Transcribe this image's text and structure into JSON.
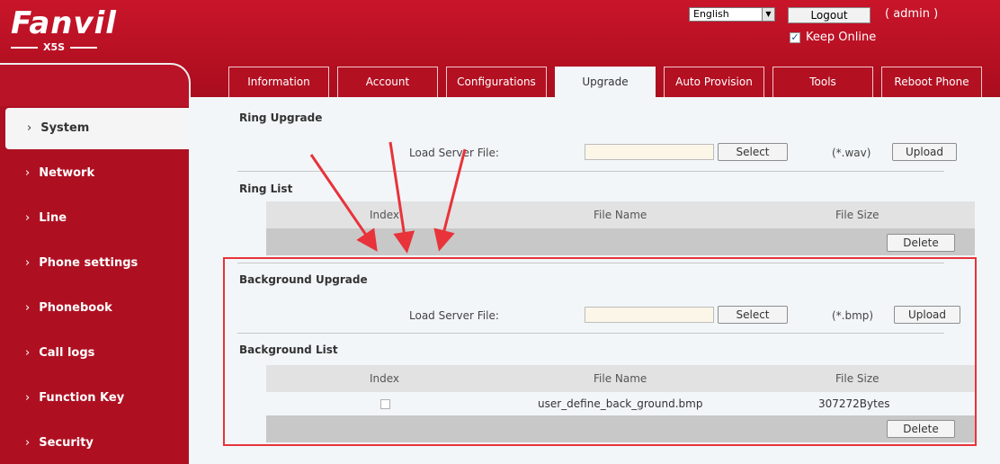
{
  "header": {
    "logo_text": "Fanvil",
    "model": "X5S",
    "language": "English",
    "logout_label": "Logout",
    "user_label": "( admin )",
    "keep_online_label": "Keep Online",
    "keep_online_checked": true
  },
  "tabs": [
    {
      "label": "Information",
      "active": false
    },
    {
      "label": "Account",
      "active": false
    },
    {
      "label": "Configurations",
      "active": false
    },
    {
      "label": "Upgrade",
      "active": true
    },
    {
      "label": "Auto Provision",
      "active": false
    },
    {
      "label": "Tools",
      "active": false
    },
    {
      "label": "Reboot Phone",
      "active": false
    }
  ],
  "sidebar": {
    "items": [
      {
        "label": "System",
        "active": true
      },
      {
        "label": "Network"
      },
      {
        "label": "Line"
      },
      {
        "label": "Phone settings"
      },
      {
        "label": "Phonebook"
      },
      {
        "label": "Call logs"
      },
      {
        "label": "Function Key"
      },
      {
        "label": "Security"
      }
    ]
  },
  "ring_upgrade": {
    "title": "Ring Upgrade",
    "load_label": "Load Server File:",
    "select_label": "Select",
    "file_type": "(*.wav)",
    "upload_label": "Upload"
  },
  "ring_list": {
    "title": "Ring List",
    "columns": [
      "Index",
      "File Name",
      "File Size"
    ],
    "delete_label": "Delete"
  },
  "background_upgrade": {
    "title": "Background Upgrade",
    "load_label": "Load Server File:",
    "select_label": "Select",
    "file_type": "(*.bmp)",
    "upload_label": "Upload"
  },
  "background_list": {
    "title": "Background List",
    "columns": [
      "Index",
      "File Name",
      "File Size"
    ],
    "rows": [
      {
        "file_name": "user_define_back_ground.bmp",
        "file_size": "307272Bytes"
      }
    ],
    "delete_label": "Delete"
  },
  "colors": {
    "brand_red": "#ae1022",
    "annotation_red": "#e8333a"
  }
}
